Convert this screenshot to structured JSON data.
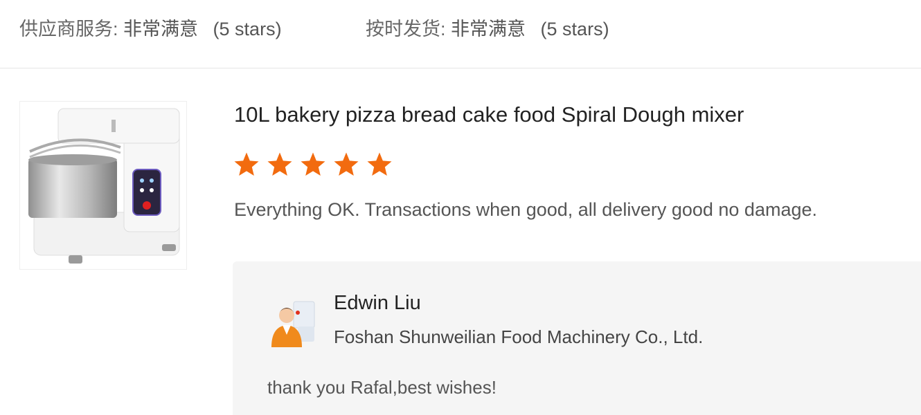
{
  "ratings": {
    "supplier_service": {
      "label": "供应商服务:",
      "value": "非常满意",
      "stars_text": "(5 stars)"
    },
    "on_time_delivery": {
      "label": "按时发货:",
      "value": "非常满意",
      "stars_text": "(5 stars)"
    }
  },
  "review": {
    "product_title": "10L bakery pizza bread cake food Spiral Dough mixer",
    "product_image": "spiral-dough-mixer-photo",
    "star_rating": 5,
    "star_color": "#f26b0f",
    "text": "Everything OK.  Transactions when good, all delivery good no damage."
  },
  "reply": {
    "name": "Edwin Liu",
    "company": "Foshan Shunweilian Food Machinery Co., Ltd.",
    "text": "thank you Rafal,best wishes!",
    "avatar": "supplier-avatar-icon"
  }
}
